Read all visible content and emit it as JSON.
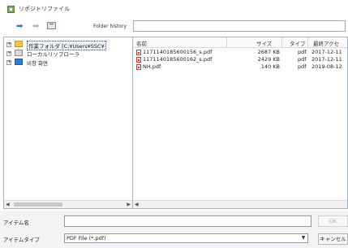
{
  "window": {
    "title": "リポジトリファイル"
  },
  "toolbar": {
    "back_icon": "back-arrow-icon",
    "forward_icon": "forward-arrow-icon",
    "up_icon": "up-folder-icon",
    "history_label": "Folder history",
    "history_value": ""
  },
  "tree": {
    "items": [
      {
        "label": "作業フォルダ [C:¥Users¥SSC¥",
        "expander": "+",
        "icon": "folder-icon"
      },
      {
        "label": "ローカルリソブローラ",
        "expander": "+",
        "icon": "drive-icon"
      },
      {
        "label": "비창 화면",
        "expander": "+",
        "icon": "network-icon"
      }
    ]
  },
  "list": {
    "columns": {
      "name": "名前",
      "size": "サイズ",
      "type": "タイプ",
      "date": "最終アクセ"
    },
    "files": [
      {
        "name": "1171140185600156_s.pdf",
        "size": "2687 KB",
        "type": "pdf",
        "date": "2017-12-11"
      },
      {
        "name": "1171140185600162_s.pdf",
        "size": "2429 KB",
        "type": "pdf",
        "date": "2017-12-11"
      },
      {
        "name": "NH.pdf",
        "size": "140 KB",
        "type": "pdf",
        "date": "2019-08-12"
      }
    ]
  },
  "bottom": {
    "filename_label": "アイテム名",
    "filename_value": "",
    "filetype_label": "アイテムタイプ",
    "filetype_value": "PDF File (*.pdf)",
    "ok_button": "OK",
    "cancel_button": "キャンセル"
  },
  "colors": {
    "accent": "#2a74c8",
    "folder": "#f0c74a",
    "pdf": "#dd3333"
  }
}
